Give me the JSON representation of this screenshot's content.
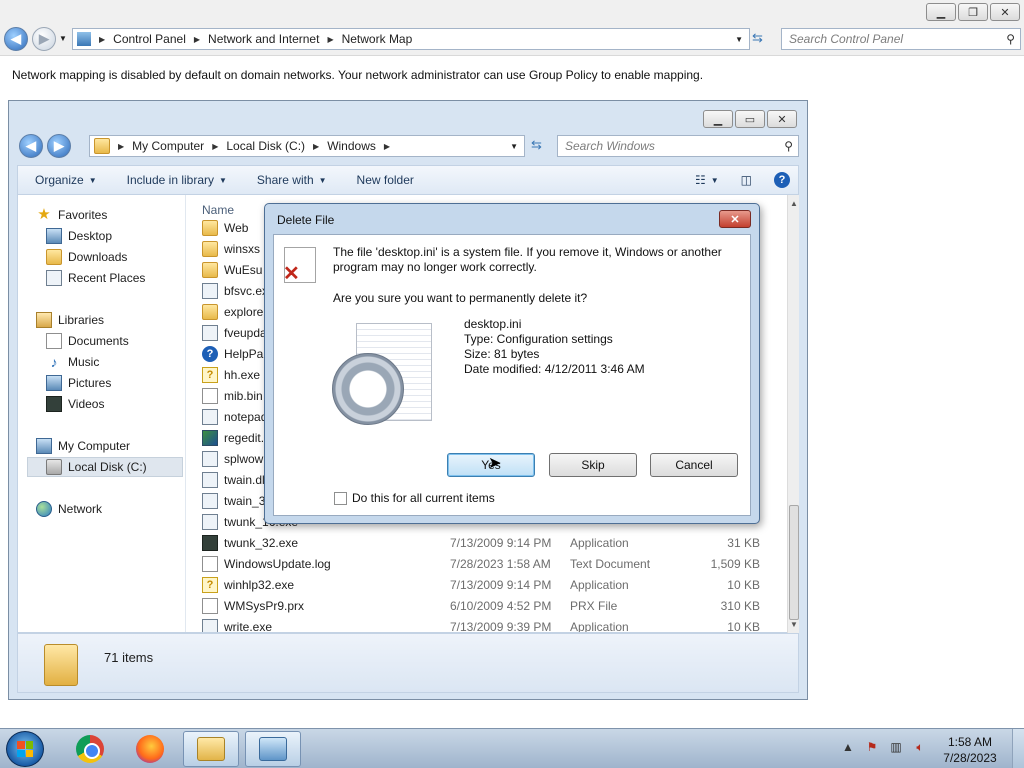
{
  "control_panel": {
    "breadcrumb": [
      "Control Panel",
      "Network and Internet",
      "Network Map"
    ],
    "search_placeholder": "Search Control Panel",
    "message": "Network mapping is disabled by default on domain networks. Your network administrator can use Group Policy to enable mapping."
  },
  "explorer": {
    "breadcrumb": [
      "My Computer",
      "Local Disk (C:)",
      "Windows"
    ],
    "search_placeholder": "Search Windows",
    "toolbar": {
      "organize": "Organize",
      "include_in_library": "Include in library",
      "share_with": "Share with",
      "new_folder": "New folder"
    },
    "nav": {
      "favorites": "Favorites",
      "desktop": "Desktop",
      "downloads": "Downloads",
      "recent_places": "Recent Places",
      "libraries": "Libraries",
      "documents": "Documents",
      "music": "Music",
      "pictures": "Pictures",
      "videos": "Videos",
      "my_computer": "My Computer",
      "local_disk": "Local Disk (C:)",
      "network": "Network"
    },
    "column_name": "Name",
    "files": [
      {
        "name": "Web",
        "icon": "folder",
        "date": "",
        "type": "",
        "size": ""
      },
      {
        "name": "winsxs",
        "icon": "folder",
        "date": "",
        "type": "",
        "size": ""
      },
      {
        "name": "WuEsu",
        "icon": "folder",
        "date": "",
        "type": "",
        "size": ""
      },
      {
        "name": "bfsvc.exe",
        "icon": "exe",
        "date": "",
        "type": "",
        "size": ""
      },
      {
        "name": "explorer.e",
        "icon": "folder-exe",
        "date": "",
        "type": "",
        "size": ""
      },
      {
        "name": "fveupdate",
        "icon": "exe",
        "date": "",
        "type": "",
        "size": ""
      },
      {
        "name": "HelpPane",
        "icon": "help",
        "date": "",
        "type": "",
        "size": ""
      },
      {
        "name": "hh.exe",
        "icon": "hh",
        "date": "",
        "type": "",
        "size": ""
      },
      {
        "name": "mib.bin",
        "icon": "file",
        "date": "",
        "type": "",
        "size": ""
      },
      {
        "name": "notepad.e",
        "icon": "exe",
        "date": "",
        "type": "",
        "size": ""
      },
      {
        "name": "regedit.ex",
        "icon": "reg",
        "date": "",
        "type": "",
        "size": ""
      },
      {
        "name": "splwow64",
        "icon": "exe",
        "date": "",
        "type": "",
        "size": ""
      },
      {
        "name": "twain.dll",
        "icon": "exe",
        "date": "",
        "type": "",
        "size": ""
      },
      {
        "name": "twain_32.",
        "icon": "exe",
        "date": "",
        "type": "",
        "size": ""
      },
      {
        "name": "twunk_16.exe",
        "icon": "exe",
        "date": "",
        "type": "",
        "size": ""
      },
      {
        "name": "twunk_32.exe",
        "icon": "dark",
        "date": "7/13/2009 9:14 PM",
        "type": "Application",
        "size": "31 KB"
      },
      {
        "name": "WindowsUpdate.log",
        "icon": "file",
        "date": "7/28/2023 1:58 AM",
        "type": "Text Document",
        "size": "1,509 KB"
      },
      {
        "name": "winhlp32.exe",
        "icon": "hh",
        "date": "7/13/2009 9:14 PM",
        "type": "Application",
        "size": "10 KB"
      },
      {
        "name": "WMSysPr9.prx",
        "icon": "file",
        "date": "6/10/2009 4:52 PM",
        "type": "PRX File",
        "size": "310 KB"
      },
      {
        "name": "write.exe",
        "icon": "exe",
        "date": "7/13/2009 9:39 PM",
        "type": "Application",
        "size": "10 KB"
      }
    ],
    "status_count": "71 items"
  },
  "dialog": {
    "title": "Delete File",
    "message": "The file 'desktop.ini' is a system file. If you remove it, Windows or another program may no longer work correctly.",
    "question": "Are you sure you want to permanently delete it?",
    "file_name": "desktop.ini",
    "file_type": "Type: Configuration settings",
    "file_size": "Size: 81 bytes",
    "file_modified": "Date modified: 4/12/2011 3:46 AM",
    "yes_label": "Yes",
    "skip_label": "Skip",
    "cancel_label": "Cancel",
    "checkbox_label": "Do this for all current items",
    "checkbox_checked": false
  },
  "taskbar": {
    "apps": [
      "chrome-icon",
      "firefox-icon",
      "explorer-icon",
      "control-panel-icon"
    ],
    "time": "1:58 AM",
    "date": "7/28/2023"
  },
  "colors": {
    "accent": "#2d69b8",
    "dialog_frame": "#c5d8ec",
    "close_red": "#c3402f"
  }
}
